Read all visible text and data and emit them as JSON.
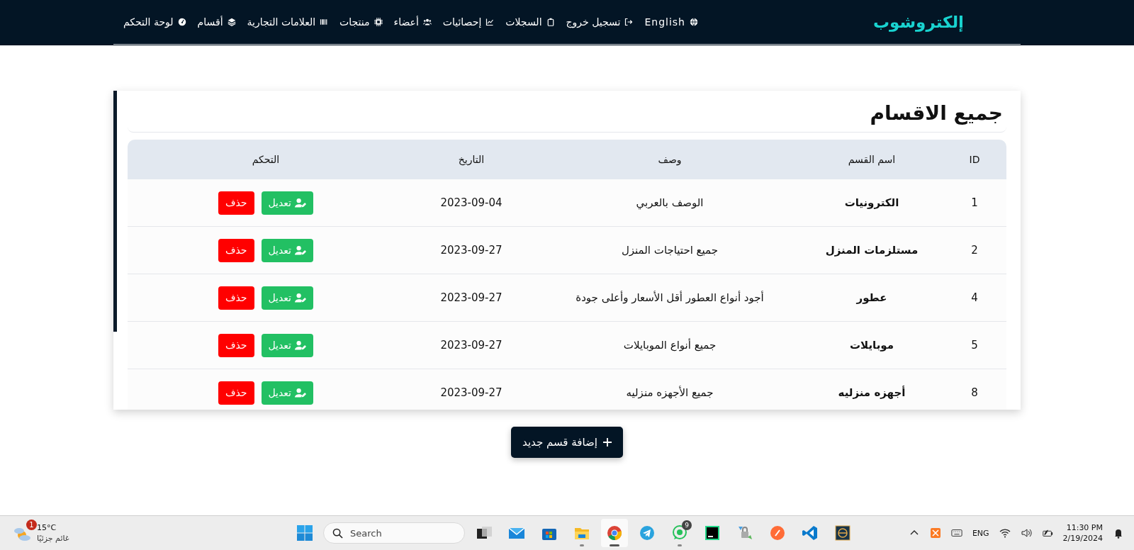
{
  "navbar": {
    "brand": "إلكتروشوب",
    "items": [
      {
        "label": "English"
      },
      {
        "label": "تسجيل خروج"
      },
      {
        "label": "السجلات"
      },
      {
        "label": "إحصائيات"
      },
      {
        "label": "أعضاء"
      },
      {
        "label": "منتجات"
      },
      {
        "label": "العلامات التجارية"
      },
      {
        "label": "أقسام"
      },
      {
        "label": "لوحة التحكم"
      }
    ]
  },
  "card": {
    "title": "جميع الاقسام",
    "table": {
      "columns": [
        "ID",
        "اسم القسم",
        "وصف",
        "التاريخ",
        "التحكم"
      ],
      "rows": [
        {
          "id": "1",
          "name": "الكترونيات",
          "description": "الوصف بالعربي",
          "date": "2023-09-04",
          "edit": "تعديل",
          "delete": "حذف"
        },
        {
          "id": "2",
          "name": "مستلزمات المنزل",
          "description": "جميع احتياجات المنزل",
          "date": "2023-09-27",
          "edit": "تعديل",
          "delete": "حذف"
        },
        {
          "id": "4",
          "name": "عطور",
          "description": "أجود أنواع العطور أقل الأسعار وأعلى جودة",
          "date": "2023-09-27",
          "edit": "تعديل",
          "delete": "حذف"
        },
        {
          "id": "5",
          "name": "موبايلات",
          "description": "جميع أنواع الموبايلات",
          "date": "2023-09-27",
          "edit": "تعديل",
          "delete": "حذف"
        },
        {
          "id": "8",
          "name": "أجهزه منزليه",
          "description": "جميع الأجهزه منزليه",
          "date": "2023-09-27",
          "edit": "تعديل",
          "delete": "حذف"
        }
      ]
    }
  },
  "add_button": "إضافة قسم جديد",
  "taskbar": {
    "weather": {
      "badge": "1",
      "temperature": "15°C",
      "condition": "غائم جزئيًا"
    },
    "search": {
      "placeholder": "Search"
    },
    "apps": [
      {
        "running": false,
        "active": false
      },
      {
        "running": false,
        "active": false
      },
      {
        "running": false,
        "active": false
      },
      {
        "running": true,
        "active": false
      },
      {
        "running": true,
        "active": true
      },
      {
        "running": false,
        "active": false
      },
      {
        "running": true,
        "active": false,
        "badge": "9"
      },
      {
        "running": false,
        "active": false
      },
      {
        "running": false,
        "active": false
      },
      {
        "running": false,
        "active": false
      },
      {
        "running": false,
        "active": false
      },
      {
        "running": false,
        "active": false
      }
    ],
    "language": "ENG",
    "time": "11:30 PM",
    "date": "2/19/2024"
  }
}
